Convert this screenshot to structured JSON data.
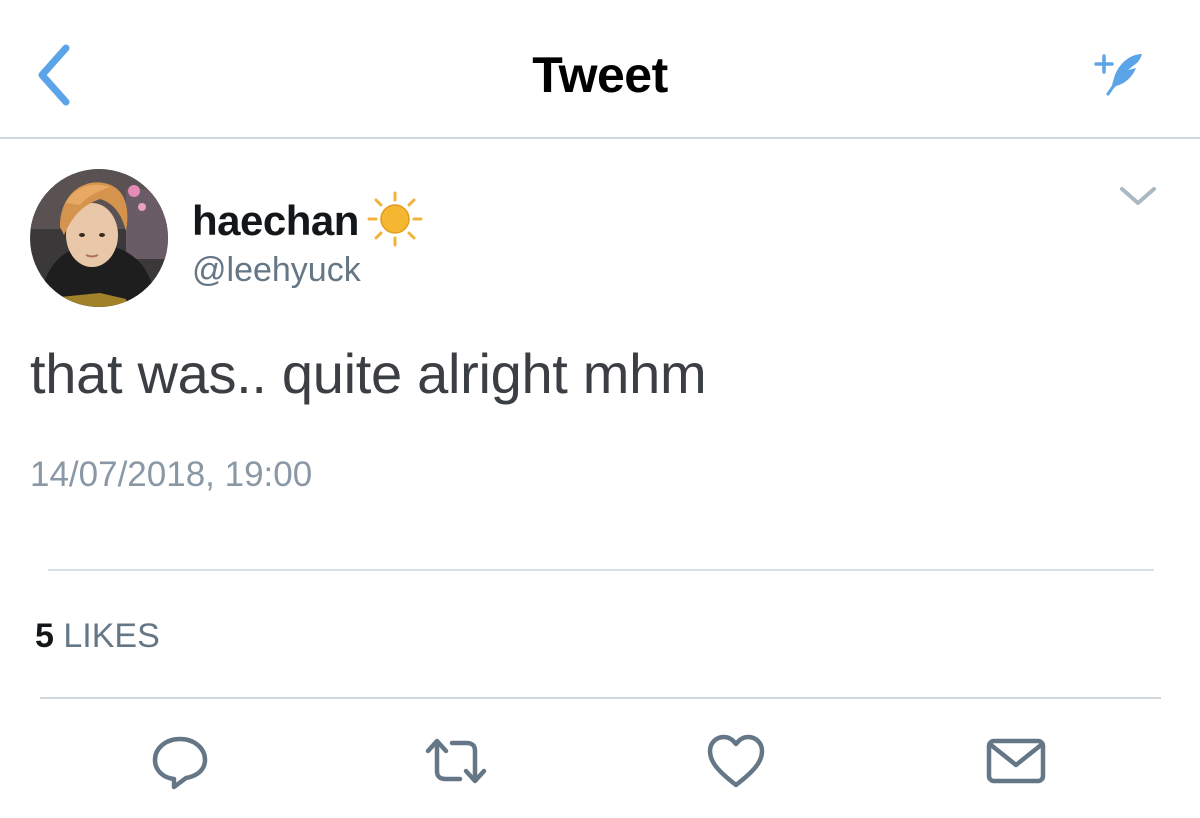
{
  "navbar": {
    "title": "Tweet",
    "back_icon": "chevron-left-icon",
    "compose_icon": "compose-tweet-icon",
    "accent_color": "#5ba4e8"
  },
  "tweet": {
    "author": {
      "display_name": "haechan",
      "emoji": "sun-icon",
      "handle": "@leehyuck"
    },
    "text": "that was.. quite alright mhm",
    "timestamp": "14/07/2018, 19:00",
    "menu_icon": "chevron-down-icon"
  },
  "stats": {
    "likes_count": "5",
    "likes_label": "LIKES"
  },
  "actions": [
    {
      "name": "reply",
      "icon": "reply-icon"
    },
    {
      "name": "retweet",
      "icon": "retweet-icon"
    },
    {
      "name": "like",
      "icon": "heart-icon"
    },
    {
      "name": "share",
      "icon": "envelope-icon"
    }
  ],
  "colors": {
    "icon_gray": "#657786",
    "divider": "#d9e0e5",
    "muted_text": "#8a98a5"
  }
}
